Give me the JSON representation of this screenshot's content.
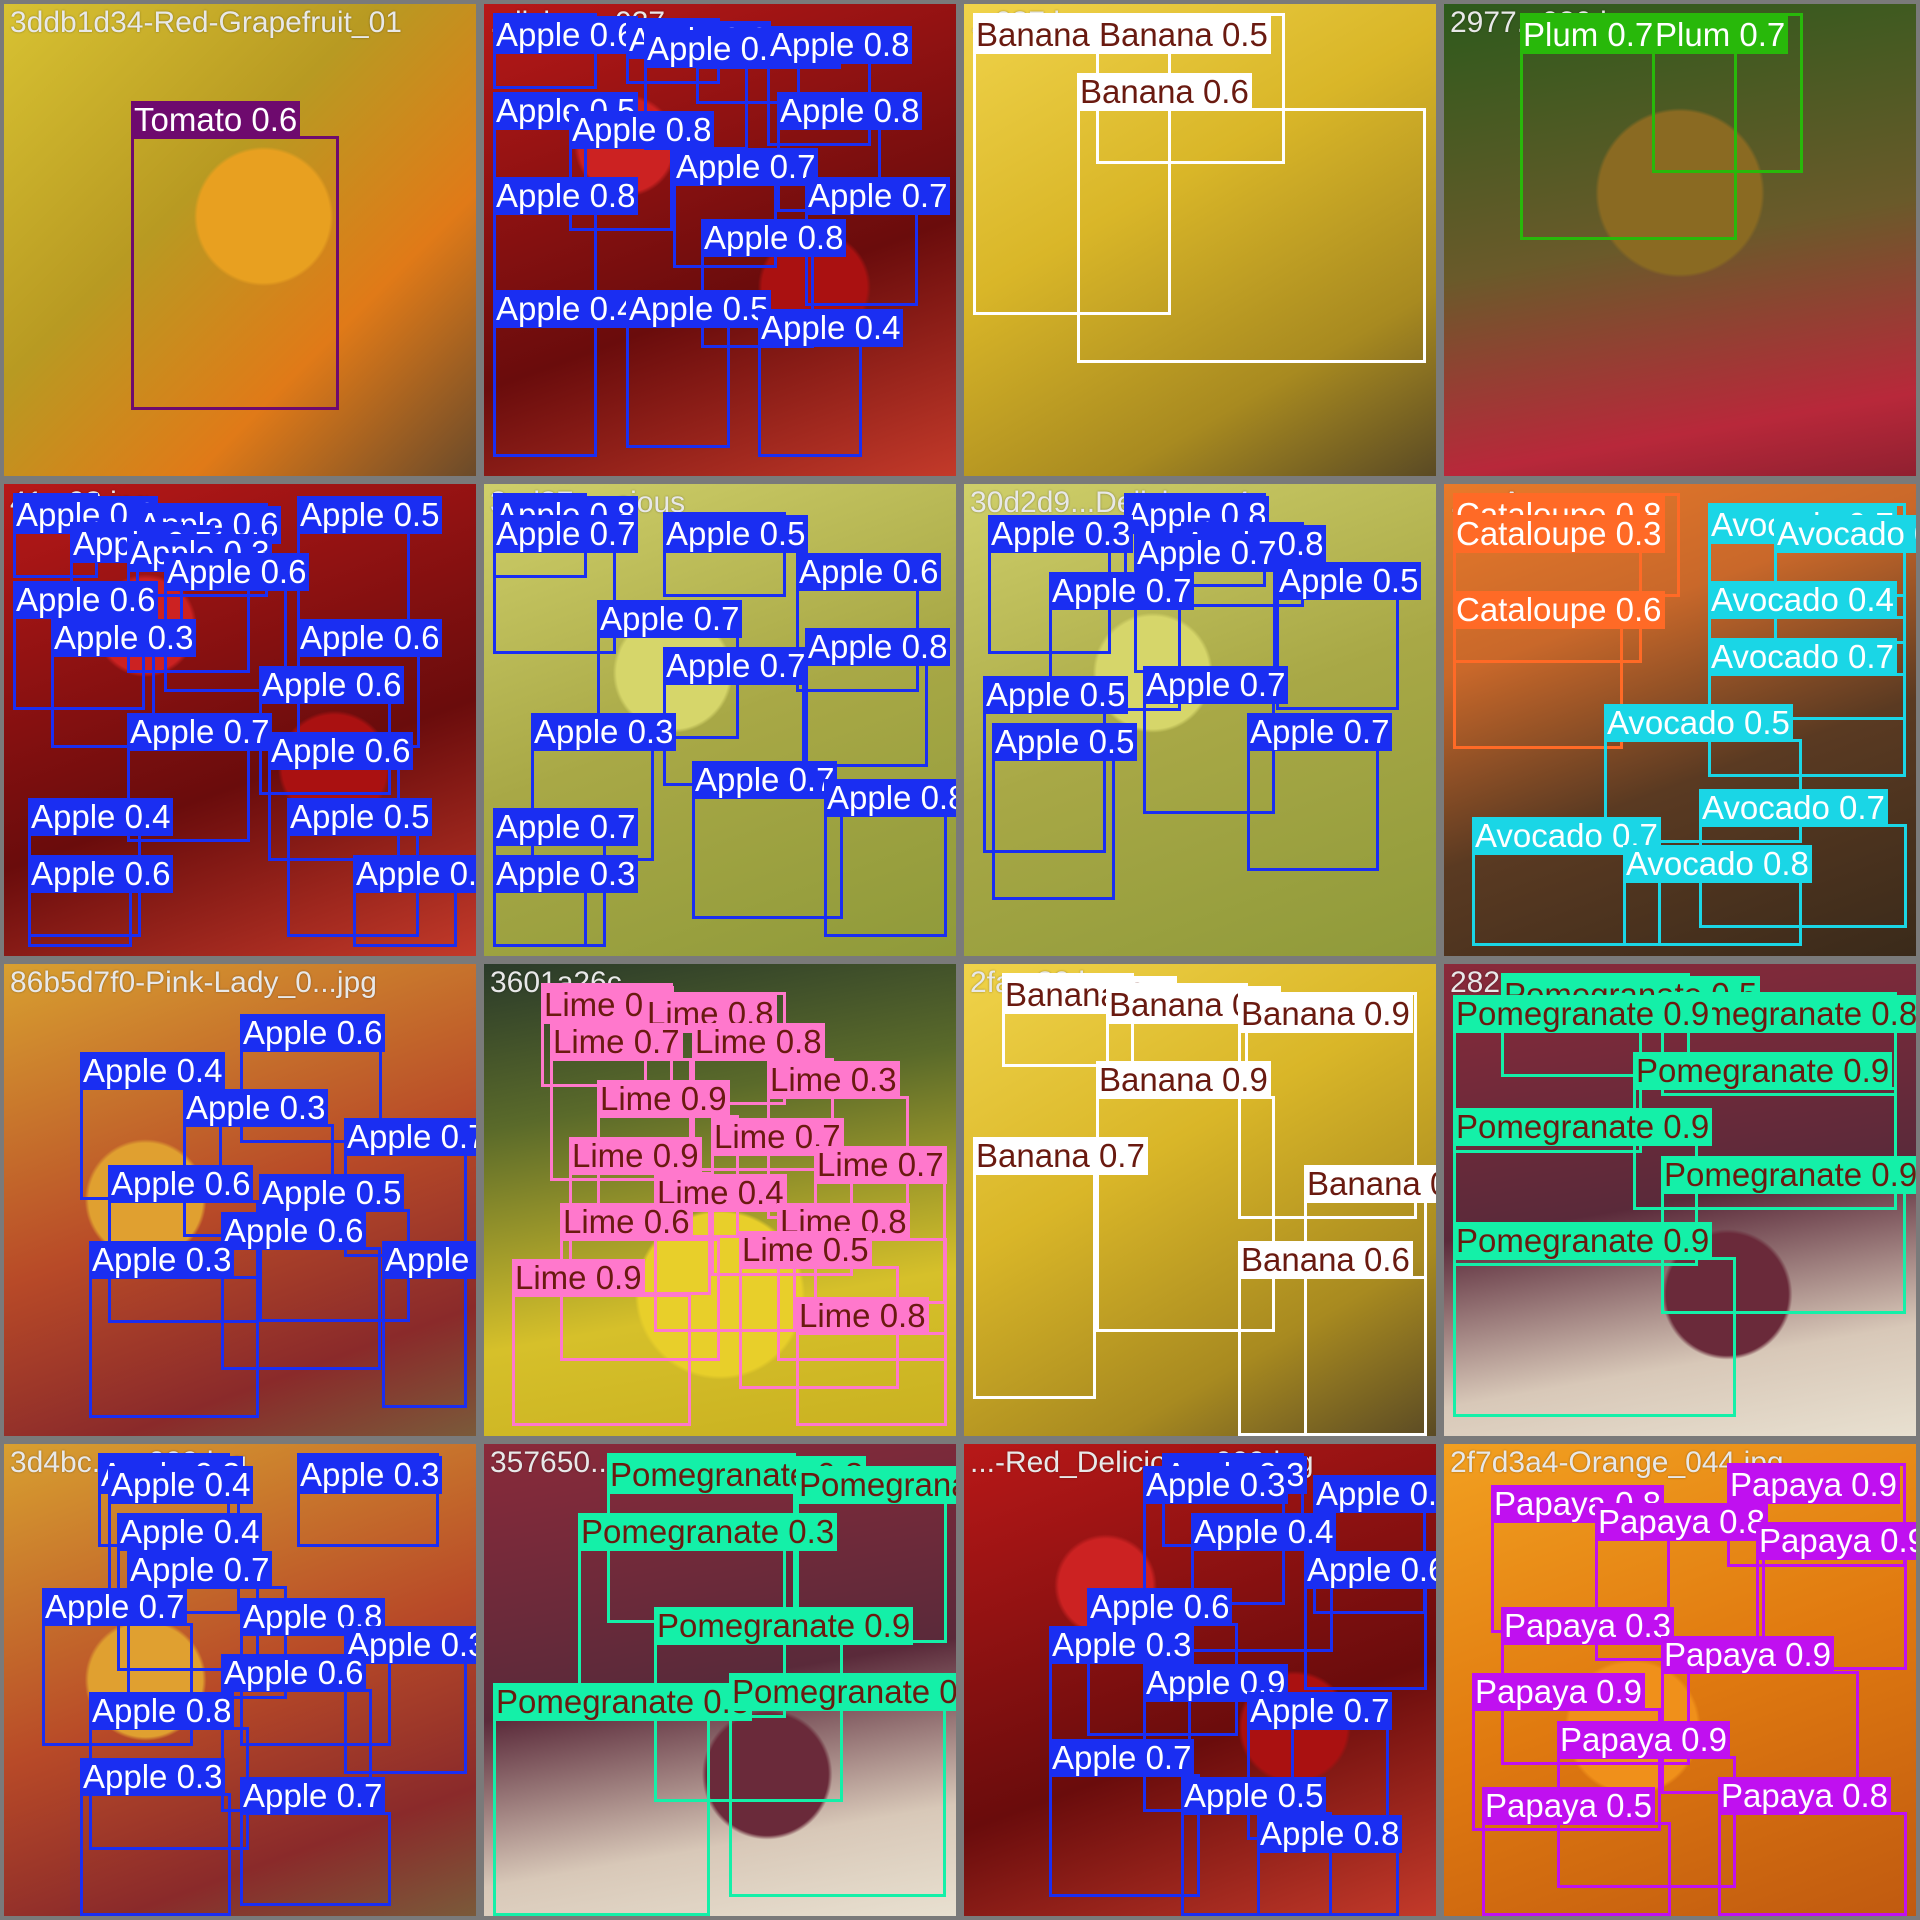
{
  "class_colors": {
    "Apple": "#1a2ef2",
    "Banana": "#ffffff",
    "Tomato": "#6e0a6e",
    "Plum": "#28b80a",
    "Cataloupe": "#ff6a26",
    "Avocado": "#1ad6e6",
    "Pomegranate": "#14f0a8",
    "Lime": "#ff78cc",
    "Papaya": "#c010f0"
  },
  "tiles": [
    {
      "filename": "3ddb1d34-Red-Grapefruit_01",
      "scene": "bananas-oranges",
      "detections": [
        {
          "cls": "Tomato",
          "score": "0.6"
        }
      ]
    },
    {
      "filename": "...licious_037",
      "scene": "red-apples",
      "detections": [
        {
          "cls": "Apple",
          "score": "0.6"
        },
        {
          "cls": "Apple",
          "score": "0.8"
        },
        {
          "cls": "Apple",
          "score": "0.8"
        },
        {
          "cls": "Apple",
          "score": "0.9"
        },
        {
          "cls": "Apple",
          "score": "0.8"
        },
        {
          "cls": "Apple",
          "score": "0.5"
        },
        {
          "cls": "Apple",
          "score": "0.8"
        },
        {
          "cls": "Apple",
          "score": "0.8"
        },
        {
          "cls": "Apple",
          "score": "0.7"
        },
        {
          "cls": "Apple",
          "score": "0.8"
        },
        {
          "cls": "Apple",
          "score": "0.7"
        },
        {
          "cls": "Apple",
          "score": "0.8"
        },
        {
          "cls": "Apple",
          "score": "0.4"
        },
        {
          "cls": "Apple",
          "score": "0.5"
        },
        {
          "cls": "Apple",
          "score": "0.4"
        }
      ]
    },
    {
      "filename": "...037.jpg",
      "scene": "bananas",
      "detections": [
        {
          "cls": "Banana",
          "score": "0.3"
        },
        {
          "cls": "Banana",
          "score": "0.5"
        },
        {
          "cls": "Banana",
          "score": "0.6"
        }
      ]
    },
    {
      "filename": "2977...020.jpg",
      "scene": "pineapples",
      "detections": [
        {
          "cls": "Plum",
          "score": "0.7"
        },
        {
          "cls": "Plum",
          "score": "0.7"
        }
      ]
    },
    {
      "filename": "41...98.jpg",
      "scene": "red-apples",
      "detections": [
        {
          "cls": "Apple",
          "score": "0.6"
        },
        {
          "cls": "Apple",
          "score": "0.6"
        },
        {
          "cls": "Apple",
          "score": "0.5"
        },
        {
          "cls": "Apple",
          "score": "0.5"
        },
        {
          "cls": "Apple",
          "score": "0.3"
        },
        {
          "cls": "Apple",
          "score": "0.6"
        },
        {
          "cls": "Apple",
          "score": "0.6"
        },
        {
          "cls": "Apple",
          "score": "0.3"
        },
        {
          "cls": "Apple",
          "score": "0.6"
        },
        {
          "cls": "Apple",
          "score": "0.6"
        },
        {
          "cls": "Apple",
          "score": "0.7"
        },
        {
          "cls": "Apple",
          "score": "0.6"
        },
        {
          "cls": "Apple",
          "score": "0.4"
        },
        {
          "cls": "Apple",
          "score": "0.5"
        },
        {
          "cls": "Apple",
          "score": "0.6"
        },
        {
          "cls": "Apple",
          "score": "0.3"
        }
      ]
    },
    {
      "filename": "3ad87a...cious",
      "scene": "green-apples",
      "detections": [
        {
          "cls": "Apple",
          "score": "0.8"
        },
        {
          "cls": "Apple",
          "score": "0.5"
        },
        {
          "cls": "Apple",
          "score": "0.7"
        },
        {
          "cls": "Apple",
          "score": "0.6"
        },
        {
          "cls": "Apple",
          "score": "0.7"
        },
        {
          "cls": "Apple",
          "score": "0.7"
        },
        {
          "cls": "Apple",
          "score": "0.8"
        },
        {
          "cls": "Apple",
          "score": "0.3"
        },
        {
          "cls": "Apple",
          "score": "0.7"
        },
        {
          "cls": "Apple",
          "score": "0.8"
        },
        {
          "cls": "Apple",
          "score": "0.7"
        },
        {
          "cls": "Apple",
          "score": "0.3"
        }
      ]
    },
    {
      "filename": "30d2d9...Delicious_4",
      "scene": "green-apples",
      "detections": [
        {
          "cls": "Apple",
          "score": "0.8"
        },
        {
          "cls": "Apple",
          "score": "0.8"
        },
        {
          "cls": "Apple",
          "score": "0.3"
        },
        {
          "cls": "Apple",
          "score": "0.7"
        },
        {
          "cls": "Apple",
          "score": "0.7"
        },
        {
          "cls": "Apple",
          "score": "0.5"
        },
        {
          "cls": "Apple",
          "score": "0.5"
        },
        {
          "cls": "Apple",
          "score": "0.7"
        },
        {
          "cls": "Apple",
          "score": "0.5"
        },
        {
          "cls": "Apple",
          "score": "0.7"
        }
      ]
    },
    {
      "filename": "...e-Avoc...",
      "scene": "avocados",
      "detections": [
        {
          "cls": "Cataloupe",
          "score": "0.8"
        },
        {
          "cls": "Cataloupe",
          "score": "0.3"
        },
        {
          "cls": "Cataloupe",
          "score": "0.6"
        },
        {
          "cls": "Avocado",
          "score": "0.7"
        },
        {
          "cls": "Avocado",
          "score": "0.8"
        },
        {
          "cls": "Avocado",
          "score": "0.4"
        },
        {
          "cls": "Avocado",
          "score": "0.7"
        },
        {
          "cls": "Avocado",
          "score": "0.5"
        },
        {
          "cls": "Avocado",
          "score": "0.7"
        },
        {
          "cls": "Avocado",
          "score": "0.7"
        },
        {
          "cls": "Avocado",
          "score": "0.8"
        }
      ]
    },
    {
      "filename": "86b5d7f0-Pink-Lady_0...jpg",
      "scene": "mixed-apples",
      "detections": [
        {
          "cls": "Apple",
          "score": "0.6"
        },
        {
          "cls": "Apple",
          "score": "0.4"
        },
        {
          "cls": "Apple",
          "score": "0.3"
        },
        {
          "cls": "Apple",
          "score": "0.7"
        },
        {
          "cls": "Apple",
          "score": "0.6"
        },
        {
          "cls": "Apple",
          "score": "0.5"
        },
        {
          "cls": "Apple",
          "score": "0.6"
        },
        {
          "cls": "Apple",
          "score": "0.3"
        },
        {
          "cls": "Apple",
          "score": "0.7"
        }
      ]
    },
    {
      "filename": "3601a26c...",
      "scene": "lemons",
      "detections": [
        {
          "cls": "Lime",
          "score": "0.6"
        },
        {
          "cls": "Lime",
          "score": "0.8"
        },
        {
          "cls": "Lime",
          "score": "0.7"
        },
        {
          "cls": "Lime",
          "score": "0.8"
        },
        {
          "cls": "Lime",
          "score": "0.9"
        },
        {
          "cls": "Lime",
          "score": "0.3"
        },
        {
          "cls": "Lime",
          "score": "0.9"
        },
        {
          "cls": "Lime",
          "score": "0.7"
        },
        {
          "cls": "Lime",
          "score": "0.4"
        },
        {
          "cls": "Lime",
          "score": "0.7"
        },
        {
          "cls": "Lime",
          "score": "0.6"
        },
        {
          "cls": "Lime",
          "score": "0.8"
        },
        {
          "cls": "Lime",
          "score": "0.5"
        },
        {
          "cls": "Lime",
          "score": "0.9"
        },
        {
          "cls": "Lime",
          "score": "0.8"
        }
      ]
    },
    {
      "filename": "2fa...30.jpg",
      "scene": "bananas",
      "detections": [
        {
          "cls": "Banana",
          "score": "0.4"
        },
        {
          "cls": "Banana",
          "score": "0.6"
        },
        {
          "cls": "Banana",
          "score": "0.9"
        },
        {
          "cls": "Banana",
          "score": "0.9"
        },
        {
          "cls": "Banana",
          "score": "0.7"
        },
        {
          "cls": "Banana",
          "score": "0.3"
        },
        {
          "cls": "Banana",
          "score": "0.6"
        }
      ]
    },
    {
      "filename": "282...",
      "scene": "pomegranates",
      "detections": [
        {
          "cls": "Pomegranate",
          "score": "0.5"
        },
        {
          "cls": "Pomegranate",
          "score": "0.8"
        },
        {
          "cls": "Pomegranate",
          "score": "0.9"
        },
        {
          "cls": "Pomegranate",
          "score": "0.9"
        },
        {
          "cls": "Pomegranate",
          "score": "0.9"
        },
        {
          "cls": "Pomegranate",
          "score": "0.9"
        },
        {
          "cls": "Pomegranate",
          "score": "0.9"
        }
      ]
    },
    {
      "filename": "3d4bc...y_009.jpg",
      "scene": "mixed-apples",
      "detections": [
        {
          "cls": "Apple",
          "score": "0.3"
        },
        {
          "cls": "Apple",
          "score": "0.3"
        },
        {
          "cls": "Apple",
          "score": "0.4"
        },
        {
          "cls": "Apple",
          "score": "0.4"
        },
        {
          "cls": "Apple",
          "score": "0.7"
        },
        {
          "cls": "Apple",
          "score": "0.7"
        },
        {
          "cls": "Apple",
          "score": "0.8"
        },
        {
          "cls": "Apple",
          "score": "0.3"
        },
        {
          "cls": "Apple",
          "score": "0.6"
        },
        {
          "cls": "Apple",
          "score": "0.8"
        },
        {
          "cls": "Apple",
          "score": "0.3"
        },
        {
          "cls": "Apple",
          "score": "0.7"
        }
      ]
    },
    {
      "filename": "357650...",
      "scene": "pomegranates",
      "detections": [
        {
          "cls": "Pomegranate",
          "score": "0.8"
        },
        {
          "cls": "Pomegranate",
          "score": "0.6"
        },
        {
          "cls": "Pomegranate",
          "score": "0.3"
        },
        {
          "cls": "Pomegranate",
          "score": "0.9"
        },
        {
          "cls": "Pomegranate",
          "score": "0.8"
        },
        {
          "cls": "Pomegranate",
          "score": "0.8"
        }
      ]
    },
    {
      "filename": "...-Red_Delicious_009.jpg",
      "scene": "red-apples",
      "detections": [
        {
          "cls": "Apple",
          "score": "0.3"
        },
        {
          "cls": "Apple",
          "score": "0.3"
        },
        {
          "cls": "Apple",
          "score": "0.3"
        },
        {
          "cls": "Apple",
          "score": "0.4"
        },
        {
          "cls": "Apple",
          "score": "0.6"
        },
        {
          "cls": "Apple",
          "score": "0.6"
        },
        {
          "cls": "Apple",
          "score": "0.3"
        },
        {
          "cls": "Apple",
          "score": "0.9"
        },
        {
          "cls": "Apple",
          "score": "0.7"
        },
        {
          "cls": "Apple",
          "score": "0.7"
        },
        {
          "cls": "Apple",
          "score": "0.5"
        },
        {
          "cls": "Apple",
          "score": "0.8"
        }
      ]
    },
    {
      "filename": "2f7d3a4-Orange_044.jpg",
      "scene": "oranges",
      "detections": [
        {
          "cls": "Papaya",
          "score": "0.9"
        },
        {
          "cls": "Papaya",
          "score": "0.8"
        },
        {
          "cls": "Papaya",
          "score": "0.8"
        },
        {
          "cls": "Papaya",
          "score": "0.9"
        },
        {
          "cls": "Papaya",
          "score": "0.3"
        },
        {
          "cls": "Papaya",
          "score": "0.9"
        },
        {
          "cls": "Papaya",
          "score": "0.9"
        },
        {
          "cls": "Papaya",
          "score": "0.9"
        },
        {
          "cls": "Papaya",
          "score": "0.5"
        },
        {
          "cls": "Papaya",
          "score": "0.8"
        }
      ]
    }
  ]
}
